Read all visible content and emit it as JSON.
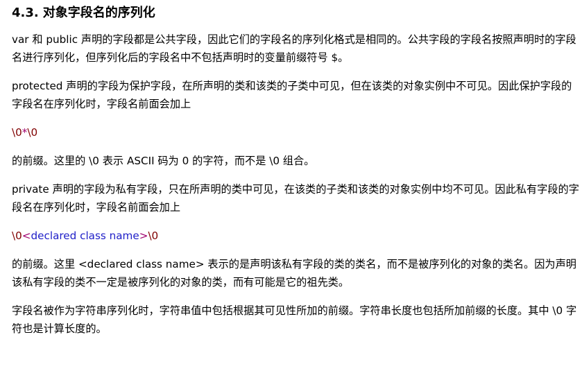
{
  "section": {
    "number": "4.3.",
    "title": "对象字段名的序列化"
  },
  "paragraphs": {
    "p1": "var 和 public 声明的字段都是公共字段，因此它们的字段名的序列化格式是相同的。公共字段的字段名按照声明时的字段名进行序列化，但序列化后的字段名中不包括声明时的变量前缀符号 $。",
    "p2": "protected 声明的字段为保护字段，在所声明的类和该类的子类中可见，但在该类的对象实例中不可见。因此保护字段的字段名在序列化时，字段名前面会加上",
    "p3": "的前缀。这里的 \\0 表示 ASCII 码为 0 的字符，而不是 \\0 组合。",
    "p4": "private 声明的字段为私有字段，只在所声明的类中可见，在该类的子类和该类的对象实例中均不可见。因此私有字段的字段名在序列化时，字段名前面会加上",
    "p5": "的前缀。这里 <declared class name> 表示的是声明该私有字段的类的类名，而不是被序列化的对象的类名。因为声明该私有字段的类不一定是被序列化的对象的类，而有可能是它的祖先类。",
    "p6": "字段名被作为字符串序列化时，字符串值中包括根据其可见性所加的前缀。字符串长度也包括所加前缀的长度。其中 \\0 字符也是计算长度的。"
  },
  "code": {
    "protected_prefix": {
      "esc1": "\\0",
      "star": "*",
      "esc2": "\\0"
    },
    "private_prefix": {
      "esc1": "\\0",
      "lt": "<",
      "name": "declared class name",
      "gt": ">",
      "esc2": "\\0"
    }
  },
  "colors": {
    "escape": "#800000",
    "operator": "#a0006e",
    "class_name": "#1e1ec8"
  }
}
